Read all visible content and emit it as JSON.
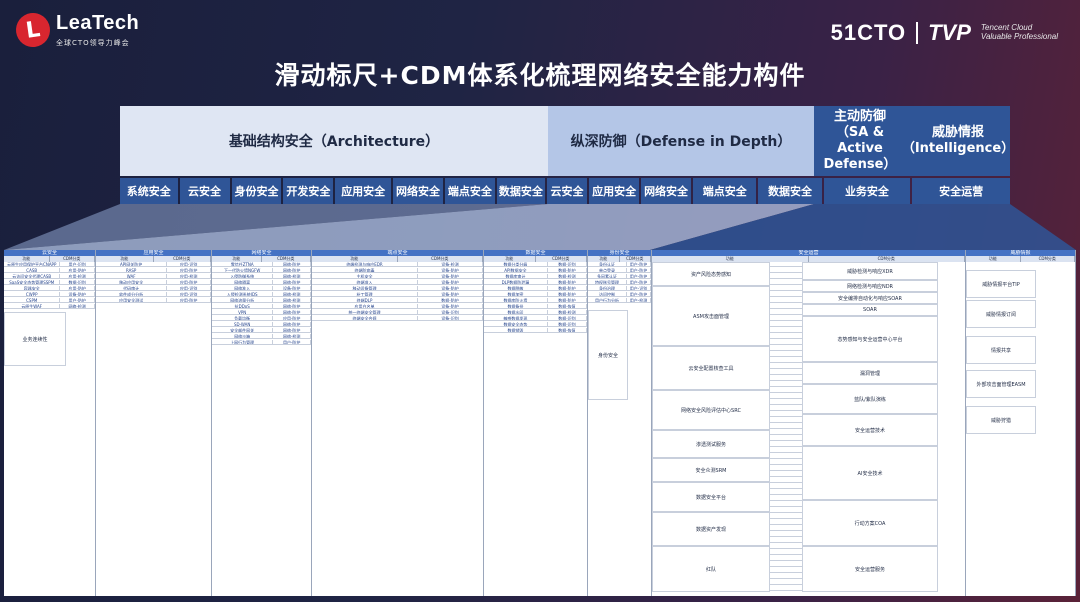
{
  "logo_left": {
    "mark": "L",
    "name": "LeaTech",
    "subtitle": "全球CTO领导力峰会"
  },
  "logo_right": {
    "brand": "51CTO",
    "tvp": "TVP",
    "tvp_sub1": "Tencent Cloud",
    "tvp_sub2": "Valuable Professional"
  },
  "title": "滑动标尺+CDM体系化梳理网络安全能力构件",
  "framework": {
    "architecture": "基础结构安全（Architecture）",
    "defense_in_depth": "纵深防御（Defense in Depth）",
    "active_defense": "主动防御（SA & Active Defense）",
    "intelligence": "威胁情报（Intelligence）",
    "arch_items": [
      "系统安全",
      "云安全",
      "身份安全",
      "开发安全",
      "应用安全",
      "网络安全",
      "端点安全",
      "数据安全"
    ],
    "did_items": [
      "云安全",
      "应用安全",
      "网络安全",
      "端点安全",
      "数据安全"
    ],
    "active_items": [
      "业务安全"
    ],
    "intel_items": [
      "安全运营"
    ]
  },
  "detail": {
    "col_headers": [
      "云安全",
      "应用安全",
      "网络安全",
      "端点安全",
      "数据安全",
      "身份安全",
      "安全运营",
      "威胁情报"
    ],
    "sub_header_a": "功能",
    "sub_header_b": "CDM分类",
    "cloud_rows": [
      [
        "云原生应用保护平台CNAPP",
        "用户-识别"
      ],
      [
        "CASB",
        "应用-防护"
      ],
      [
        "云访问安全代理CASB",
        "应用-检测"
      ],
      [
        "SaaS安全态势管理SSPM",
        "数据-识别"
      ],
      [
        "容器安全",
        "应用-防护"
      ],
      [
        "CWPP",
        "设备-防护"
      ],
      [
        "CSPM",
        "用户-防护"
      ],
      [
        "云原生WAF",
        "网络-检测"
      ]
    ],
    "cloud_big": "业务连续性",
    "app_rows": [
      [
        "API网关防护",
        "应用-识别"
      ],
      [
        "RASP",
        "应用-防护"
      ],
      [
        "WAF",
        "应用-检测"
      ],
      [
        "移动应用安全",
        "应用-防护"
      ],
      [
        "代码审计",
        "应用-识别"
      ],
      [
        "软件成分分析",
        "应用-识别"
      ],
      [
        "应用安全测试",
        "应用-防护"
      ]
    ],
    "net_rows": [
      [
        "零信任ZTNA",
        "网络-防护"
      ],
      [
        "下一代防火墙NGFW",
        "网络-防护"
      ],
      [
        "入侵防御系统",
        "网络-检测"
      ],
      [
        "网络隔离",
        "网络-防护"
      ],
      [
        "网络准入",
        "设备-防护"
      ],
      [
        "入侵检测系统IDS",
        "网络-检测"
      ],
      [
        "网络流量分析",
        "网络-检测"
      ],
      [
        "抗DDoS",
        "网络-防护"
      ],
      [
        "VPN",
        "网络-防护"
      ],
      [
        "负载均衡",
        "应用-防护"
      ],
      [
        "SD-WAN",
        "网络-防护"
      ],
      [
        "安全邮件网关",
        "网络-防护"
      ],
      [
        "网络沙箱",
        "网络-检测"
      ],
      [
        "上网行为管理",
        "用户-防护"
      ]
    ],
    "endpoint_rows": [
      [
        "终端检测与响应EDR",
        "设备-检测"
      ],
      [
        "终端防病毒",
        "设备-防护"
      ],
      [
        "主机安全",
        "设备-防护"
      ],
      [
        "终端准入",
        "设备-防护"
      ],
      [
        "移动设备管理",
        "设备-防护"
      ],
      [
        "补丁管理",
        "设备-防护"
      ],
      [
        "终端DLP",
        "数据-防护"
      ],
      [
        "应用白名单",
        "设备-防护"
      ],
      [
        "统一终端安全管理",
        "设备-识别"
      ],
      [
        "终端安全合规",
        "设备-识别"
      ]
    ],
    "data_rows": [
      [
        "数据分类分级",
        "数据-识别"
      ],
      [
        "API数据安全",
        "数据-防护"
      ],
      [
        "数据库审计",
        "数据-检测"
      ],
      [
        "DLP数据防泄漏",
        "数据-防护"
      ],
      [
        "数据脱敏",
        "数据-防护"
      ],
      [
        "数据加密",
        "数据-防护"
      ],
      [
        "数据库防火墙",
        "数据-防护"
      ],
      [
        "数据备份",
        "数据-恢复"
      ],
      [
        "数据水印",
        "数据-检测"
      ],
      [
        "敏感数据发现",
        "数据-识别"
      ],
      [
        "数据安全态势",
        "数据-识别"
      ],
      [
        "数据销毁",
        "数据-恢复"
      ]
    ],
    "identity_rows": [
      [
        "身份认证",
        "用户-防护"
      ],
      [
        "单点登录",
        "用户-防护"
      ],
      [
        "多因素认证",
        "用户-防护"
      ],
      [
        "特权账号管理",
        "用户-防护"
      ],
      [
        "身份治理",
        "用户-识别"
      ],
      [
        "访问控制",
        "用户-防护"
      ],
      [
        "用户行为分析",
        "用户-检测"
      ]
    ],
    "identity_big": "身份安全",
    "ops_left": [
      "资产风险态势感知",
      "ASM攻击面管理",
      "云安全配置核查工具",
      "网络安全风险评估中心SRC",
      "渗透测试服务",
      "安全众测SRM",
      "数据安全平台",
      "数据资产发现",
      "红队"
    ],
    "ops_mid": [
      "威胁检测与响应XDR",
      "网络检测与响应NDR",
      "安全编排自动化与响应SOAR",
      "SOAR",
      "态势感知与安全运营中心平台",
      "漏洞管理",
      "蓝队/紫队演练",
      "安全运营技术",
      "AI安全技术",
      "行动方案COA",
      "安全运营服务"
    ],
    "intel_rows": [
      "威胁情报平台TIP",
      "威胁情报订阅",
      "情报共享",
      "外部攻击面管理EASM",
      "威胁狩猎"
    ]
  }
}
